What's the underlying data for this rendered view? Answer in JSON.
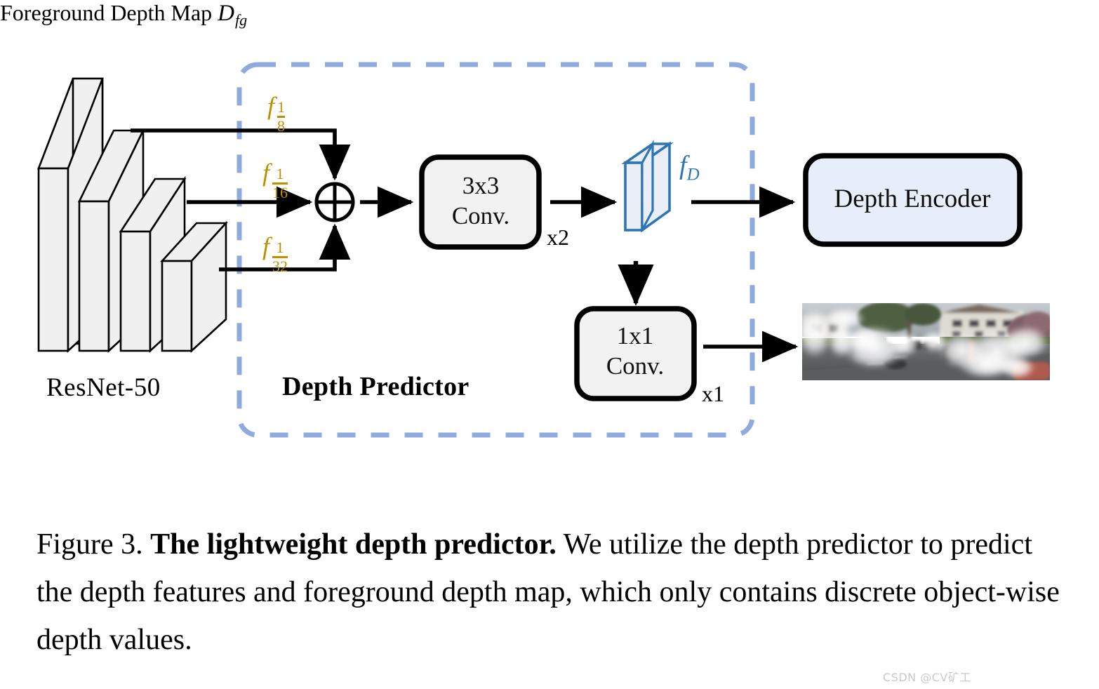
{
  "figure": {
    "backbone_label": "ResNet-50",
    "group_label": "Depth Predictor",
    "fd_symbol": "f",
    "fd_subscript": "D",
    "features": [
      {
        "base": "f",
        "num": "1",
        "den": "8"
      },
      {
        "base": "f",
        "num": "1",
        "den": "16"
      },
      {
        "base": "f",
        "num": "1",
        "den": "32"
      }
    ],
    "blocks": {
      "conv3x3_line1": "3x3",
      "conv3x3_line2": "Conv.",
      "conv3x3_repeat": "x2",
      "conv1x1_line1": "1x1",
      "conv1x1_line2": "Conv.",
      "conv1x1_repeat": "x1",
      "depth_encoder": "Depth Encoder"
    },
    "output": {
      "label_text": "Foreground Depth Map",
      "symbol": "D",
      "subscript": "fg"
    },
    "colors": {
      "feature_gold": "#BF8F00",
      "fd_blue": "#2E75B6",
      "dashed_border_blue": "#8FAADC",
      "depth_encoder_fill": "#E8EEF9",
      "conv_box_fill": "#F2F2F2",
      "block_outline": "#000000",
      "fd_block_outline": "#2E75B6",
      "fd_block_fill": "#EAEFF7",
      "resnet_block_fill": "#F0F0F0"
    }
  },
  "caption": {
    "prefix": "Figure 3. ",
    "bold": "The lightweight depth predictor.",
    "rest": " We utilize the depth predictor to predict the depth features and foreground depth map, which only contains discrete object-wise depth values."
  },
  "watermark": {
    "text": "CSDN @CV矿工"
  }
}
